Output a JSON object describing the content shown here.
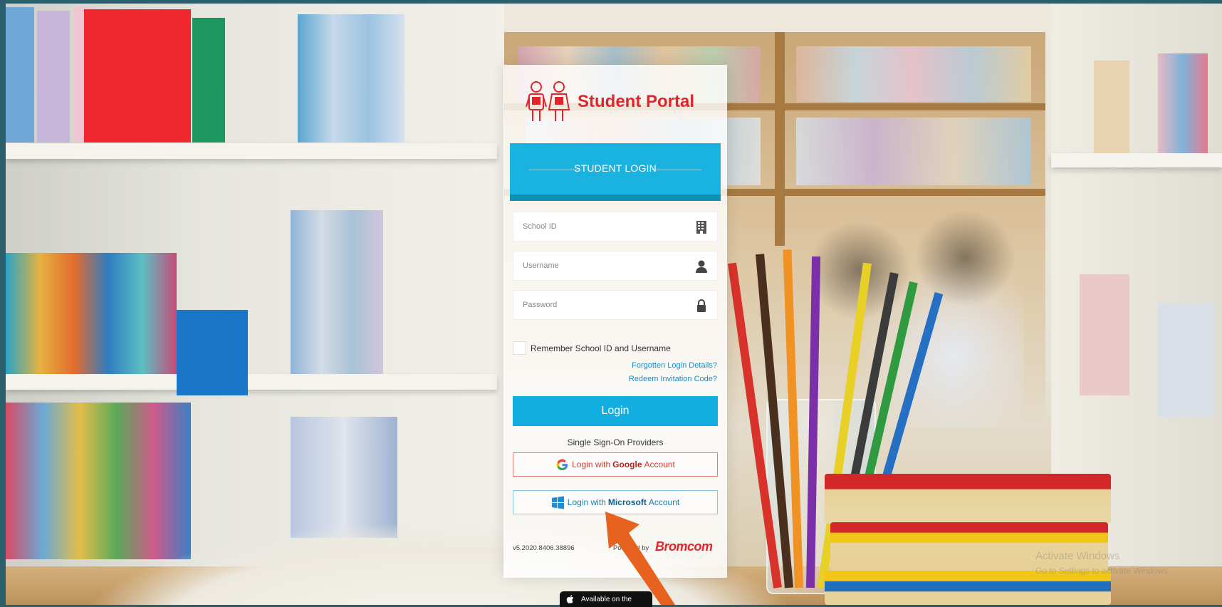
{
  "app": {
    "title": "Student Portal"
  },
  "login": {
    "banner": "STUDENT LOGIN",
    "school_id_placeholder": "School ID",
    "username_placeholder": "Username",
    "password_placeholder": "Password",
    "remember_label": "Remember School ID and Username",
    "forgotten_link": "Forgotten Login Details?",
    "redeem_link": "Redeem Invitation Code?",
    "login_button": "Login",
    "sso_label": "Single Sign-On Providers",
    "google": {
      "prefix": "Login with",
      "brand": "Google",
      "suffix": "Account"
    },
    "microsoft": {
      "prefix": "Login with",
      "brand": "Microsoft",
      "suffix": "Account"
    },
    "version": "v5.2020.8406.38896",
    "powered_by": "Powered by",
    "vendor": "Bromcom"
  },
  "appstore": {
    "label": "Available on the"
  },
  "watermark": {
    "title": "Activate Windows",
    "subtitle": "Go to Settings to activate Windows."
  },
  "colors": {
    "brand_red": "#e2252b",
    "primary_blue": "#12aee0",
    "link_blue": "#1a8ec7",
    "annotation_orange": "#e8621f"
  },
  "icons": [
    "student-logo-icon",
    "building-icon",
    "user-icon",
    "lock-icon",
    "google-icon",
    "windows-icon",
    "apple-icon",
    "annotation-arrow-icon"
  ]
}
